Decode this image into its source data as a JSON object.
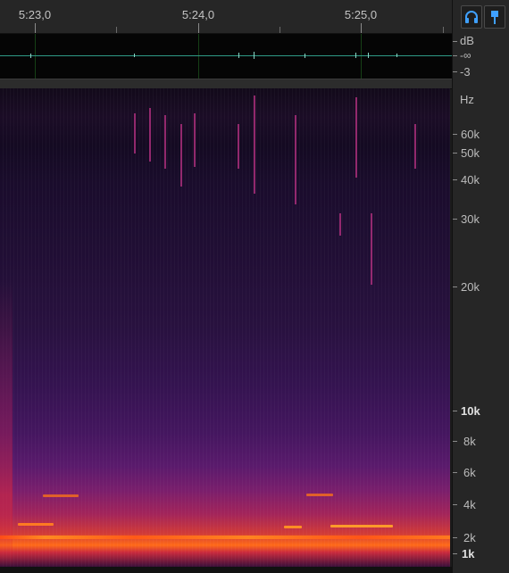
{
  "ruler": {
    "labels": [
      "5:23,0",
      "5:24,0",
      "5:25,0"
    ]
  },
  "level_scale": {
    "unit": "dB",
    "labels": [
      "-∞",
      "-3"
    ]
  },
  "freq_scale": {
    "unit": "Hz",
    "labels": [
      "60k",
      "50k",
      "40k",
      "30k",
      "20k",
      "10k",
      "8k",
      "6k",
      "4k",
      "2k",
      "1k"
    ]
  },
  "buttons": {
    "listen_icon": "headphones-icon",
    "marker_icon": "marker-flag-icon"
  },
  "colors": {
    "accent": "#3fa0ff",
    "waveform": "#2f9a86"
  }
}
